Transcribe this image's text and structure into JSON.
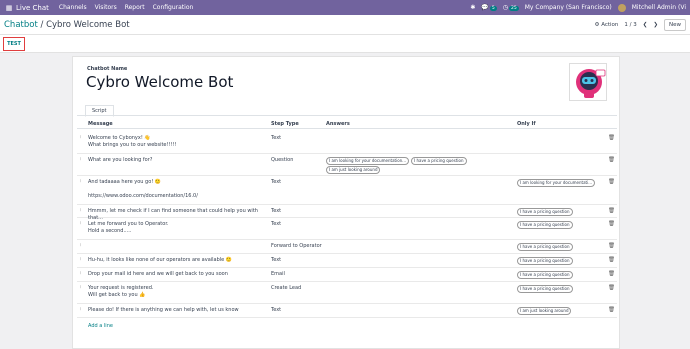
{
  "navbar": {
    "app_name": "Live Chat",
    "menus": [
      "Channels",
      "Visitors",
      "Report",
      "Configuration"
    ],
    "chat_badge": "5",
    "activity_badge": "25",
    "company": "My Company (San Francisco)",
    "user": "Mitchell Admin (Vi"
  },
  "control": {
    "breadcrumb_parent": "Chatbot",
    "breadcrumb_sep": "/",
    "breadcrumb_current": "Cybro Welcome Bot",
    "action_label": "Action",
    "pager": "1 / 3",
    "new_label": "New"
  },
  "status": {
    "test_label": "TEST"
  },
  "form": {
    "name_label": "Chatbot Name",
    "name_value": "Cybro Welcome Bot",
    "tab_script": "Script",
    "columns": {
      "message": "Message",
      "step_type": "Step Type",
      "answers": "Answers",
      "only_if": "Only If"
    },
    "add_line": "Add a line"
  },
  "rows": [
    {
      "message": "Welcome to Cybonyx! 👋\nWhat brings you to our website!!!!!",
      "step": "Text",
      "answers": [],
      "only_if": []
    },
    {
      "message": "What are you looking for?",
      "step": "Question",
      "answers": [
        "I am looking for your documentation...",
        "I have a pricing question",
        "I am just looking around"
      ],
      "only_if": []
    },
    {
      "message": "And tadaaaa here you go! 🙂\n\nhttps://www.odoo.com/documentation/16.0/",
      "step": "Text",
      "answers": [],
      "only_if": [
        "I am looking for your documentati..."
      ]
    },
    {
      "message": "Hmmm, let me check if I can find someone that could help you with that...",
      "step": "Text",
      "answers": [],
      "only_if": [
        "I have a pricing question"
      ]
    },
    {
      "message": "Let me forward you to Operator.\nHold a second.....",
      "step": "Text",
      "answers": [],
      "only_if": [
        "I have a pricing question"
      ]
    },
    {
      "message": "",
      "step": "Forward to Operator",
      "answers": [],
      "only_if": [
        "I have a pricing question"
      ]
    },
    {
      "message": "Hu-hu, it looks like none of our operators are available 🙁",
      "step": "Text",
      "answers": [],
      "only_if": [
        "I have a pricing question"
      ]
    },
    {
      "message": "Drop your mail id here and we will get back to you soon",
      "step": "Email",
      "answers": [],
      "only_if": [
        "I have a pricing question"
      ]
    },
    {
      "message": "Your request is registered.\nWill get back to you 👍",
      "step": "Create Lead",
      "answers": [],
      "only_if": [
        "I have a pricing question"
      ]
    },
    {
      "message": "Please do! If there is anything we can help with, let us know",
      "step": "Text",
      "answers": [],
      "only_if": [
        "I am just looking around"
      ]
    }
  ]
}
